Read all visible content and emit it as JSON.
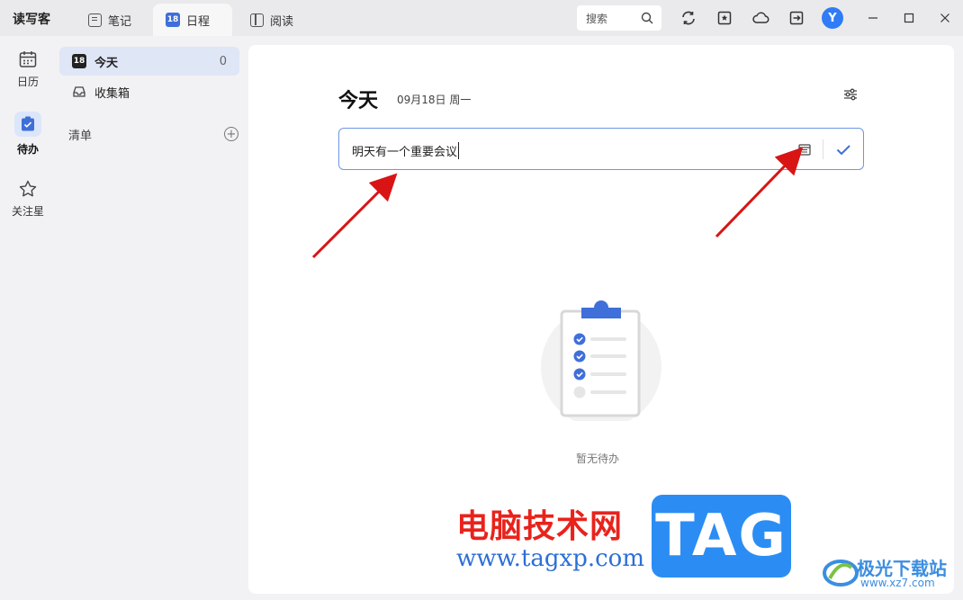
{
  "app": {
    "name": "读写客"
  },
  "tabs": [
    {
      "label": "笔记",
      "icon": "note-icon"
    },
    {
      "label": "日程",
      "icon": "calendar-18-icon",
      "badge": "18"
    },
    {
      "label": "阅读",
      "icon": "book-icon"
    }
  ],
  "toolbar": {
    "search_label": "搜索",
    "avatar_letter": "Y",
    "icons": [
      "sync-icon",
      "star-note-icon",
      "cloud-icon",
      "export-icon"
    ]
  },
  "rail": {
    "items": [
      {
        "label": "日历",
        "icon": "calendar-icon"
      },
      {
        "label": "待办",
        "icon": "todo-check-icon",
        "active": true
      },
      {
        "label": "关注星",
        "icon": "star-icon"
      }
    ]
  },
  "sidebar": {
    "today": {
      "label": "今天",
      "badge": "18",
      "count": "0"
    },
    "inbox": {
      "label": "收集箱"
    },
    "list_header": "清单"
  },
  "main": {
    "title": "今天",
    "date": "09月18日 周一",
    "task_input_value": "明天有一个重要会议",
    "empty_text": "暂无待办"
  },
  "watermark": {
    "cn": "电脑技术网",
    "url": "www.tagxp.com",
    "tag": "TAG",
    "jg_name": "极光下载站",
    "jg_url": "www.xz7.com"
  },
  "colors": {
    "accent": "#3f6fd8",
    "avatar": "#2f7cf6",
    "arrow": "#d91414",
    "watermark_red": "#e8231c",
    "watermark_blue": "#2b8df4"
  }
}
